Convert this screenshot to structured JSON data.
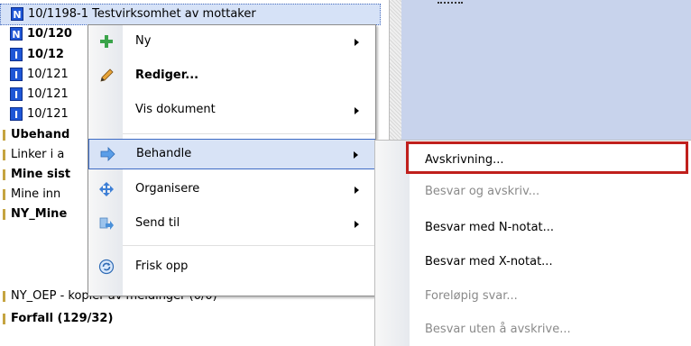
{
  "list": {
    "rows": [
      {
        "badge": "N",
        "text": "10/1198-1 Testvirksomhet av mottaker",
        "bold": false,
        "selected": true
      },
      {
        "badge": "N",
        "text": "10/120",
        "bold": true
      },
      {
        "badge": "I",
        "text": "10/12",
        "bold": true
      },
      {
        "badge": "I",
        "text": "10/121",
        "bold": false
      },
      {
        "badge": "I",
        "text": "10/121",
        "bold": false
      },
      {
        "badge": "I",
        "text": "10/121",
        "bold": false
      }
    ],
    "folders": [
      {
        "text": "Ubehand",
        "bold": true
      },
      {
        "text": "Linker i a",
        "bold": false
      },
      {
        "text": "Mine sist",
        "bold": true
      },
      {
        "text": "Mine inn",
        "bold": false
      },
      {
        "text": "NY_Mine",
        "bold": true
      },
      {
        "text": "NY_OEP - kopier av meldinger (0/0)",
        "bold": false
      },
      {
        "text": "Forfall (129/32)",
        "bold": true
      }
    ]
  },
  "context_menu": {
    "items": [
      {
        "label": "Ny",
        "icon": "add-plus-icon",
        "submenu": true
      },
      {
        "label": "Rediger...",
        "icon": "pencil-icon",
        "submenu": false,
        "bold": true
      },
      {
        "label": "Vis dokument",
        "icon": "",
        "submenu": true
      },
      {
        "label": "Behandle",
        "icon": "process-arrow-icon",
        "submenu": true,
        "active": true
      },
      {
        "label": "Organisere",
        "icon": "move-arrows-icon",
        "submenu": true
      },
      {
        "label": "Send til",
        "icon": "send-to-icon",
        "submenu": true
      },
      {
        "label": "Frisk opp",
        "icon": "refresh-icon",
        "submenu": false
      }
    ]
  },
  "submenu": {
    "items": [
      {
        "label": "Avskrivning...",
        "enabled": true,
        "highlighted": true
      },
      {
        "label": "Besvar og avskriv...",
        "enabled": false
      },
      {
        "label": "Besvar med N-notat...",
        "enabled": true
      },
      {
        "label": "Besvar med X-notat...",
        "enabled": true
      },
      {
        "label": "Foreløpig svar...",
        "enabled": false
      },
      {
        "label": "Besvar uten å avskrive...",
        "enabled": false
      }
    ]
  },
  "colors": {
    "accent": "#3d6bc4",
    "highlight_border": "#c0201c",
    "badge_blue": "#1e56d6"
  }
}
